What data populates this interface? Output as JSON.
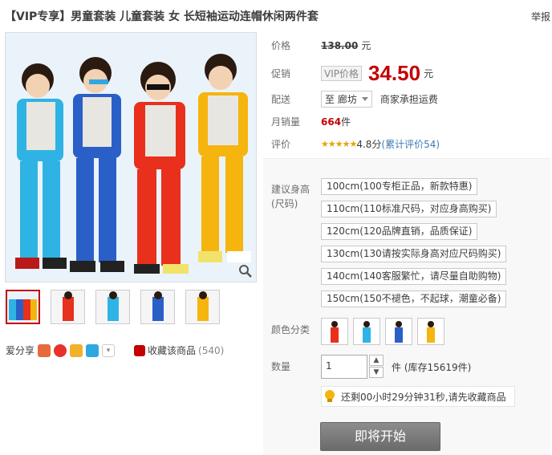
{
  "product": {
    "title": "【VIP专享】男童套装 儿童套装 女 长短袖运动连帽休闲两件套",
    "report": "举报"
  },
  "price": {
    "label": "价格",
    "original": "138.00",
    "unit": "元"
  },
  "promo": {
    "label": "促销",
    "tag": "VIP价格",
    "price": "34.50",
    "unit": "元"
  },
  "delivery": {
    "label": "配送",
    "to": "至 廊坊",
    "shipping": "商家承担运费"
  },
  "monthly_sales": {
    "label": "月销量",
    "value": "664",
    "unit": "件"
  },
  "rating": {
    "label": "评价",
    "stars": "★★★★★",
    "score": "4.8分",
    "reviews": "(累计评价54)"
  },
  "size": {
    "label": "建议身高(尺码)",
    "options": [
      "100cm(100专柜正品，新款特惠)",
      "110cm(110标准尺码，对应身高购买)",
      "120cm(120品牌直销，品质保证)",
      "130cm(130请按实际身高对应尺码购买)",
      "140cm(140客服繁忙，请尽量自助购物)",
      "150cm(150不褪色，不起球，潮童必备)"
    ]
  },
  "color": {
    "label": "颜色分类"
  },
  "quantity": {
    "label": "数量",
    "value": "1",
    "stock": "件 (库存15619件)"
  },
  "tip": {
    "text": "还剩00小时29分钟31秒,请先收藏商品"
  },
  "buy_button": "即将开始",
  "share": {
    "label": "爱分享",
    "favorite": "收藏该商品",
    "fav_count": "(540)"
  },
  "colors": {
    "brand_red": "#c40000",
    "accent_orange": "#e8a300"
  }
}
